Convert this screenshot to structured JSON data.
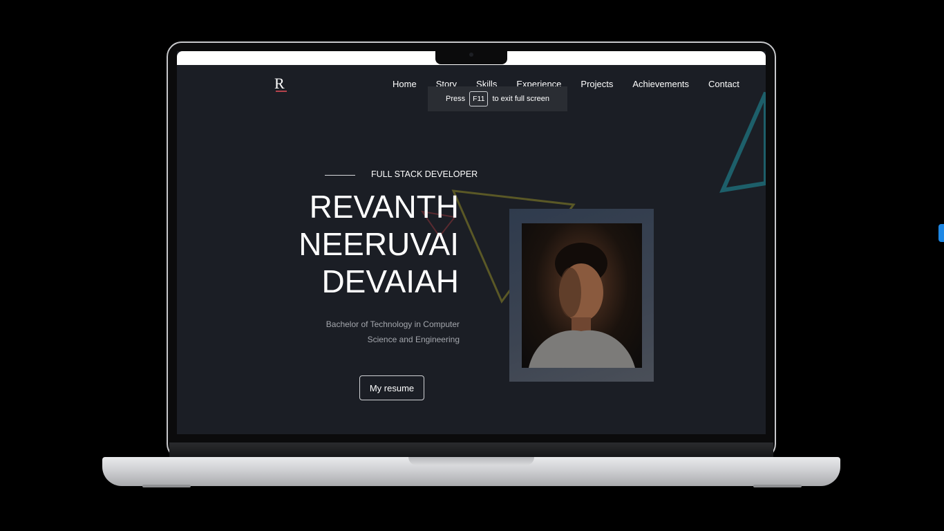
{
  "site": {
    "logo_letter": "R",
    "nav": [
      "Home",
      "Story",
      "Skills",
      "Experience",
      "Projects",
      "Achievements",
      "Contact"
    ],
    "fullscreen_notice": {
      "before": "Press",
      "key": "F11",
      "after": "to exit full screen"
    },
    "hero": {
      "role": "FULL STACK DEVELOPER",
      "name_lines": [
        "REVANTH",
        "NEERUVAI",
        "DEVAIAH"
      ],
      "degree_lines": [
        "Bachelor of Technology in Computer",
        "Science and Engineering"
      ],
      "resume_button": "My resume"
    }
  },
  "colors": {
    "page_bg": "#1b1e25",
    "teal_triangle": "#1d5f6a",
    "olive_triangle": "#5a5826",
    "red_triangle": "#5a2a30",
    "accent_underline": "#b5434c"
  }
}
